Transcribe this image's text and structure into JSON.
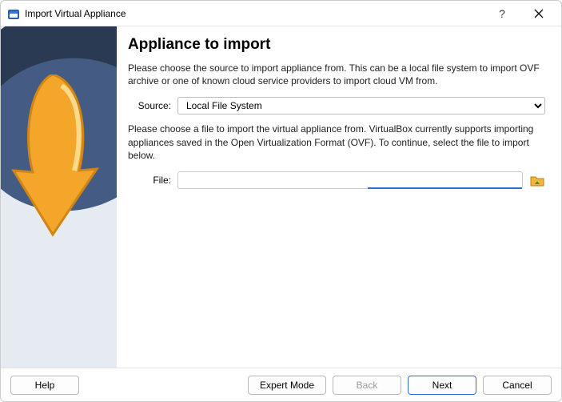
{
  "window": {
    "title": "Import Virtual Appliance"
  },
  "page": {
    "heading": "Appliance to import",
    "intro": "Please choose the source to import appliance from. This can be a local file system to import OVF archive or one of known cloud service providers to import cloud VM from.",
    "source_label": "Source:",
    "source_value": "Local File System",
    "file_hint": "Please choose a file to import the virtual appliance from. VirtualBox currently supports importing appliances saved in the Open Virtualization Format (OVF). To continue, select the file to import below.",
    "file_label": "File:",
    "file_value": ""
  },
  "buttons": {
    "help": "Help",
    "expert": "Expert Mode",
    "back": "Back",
    "next": "Next",
    "cancel": "Cancel"
  }
}
